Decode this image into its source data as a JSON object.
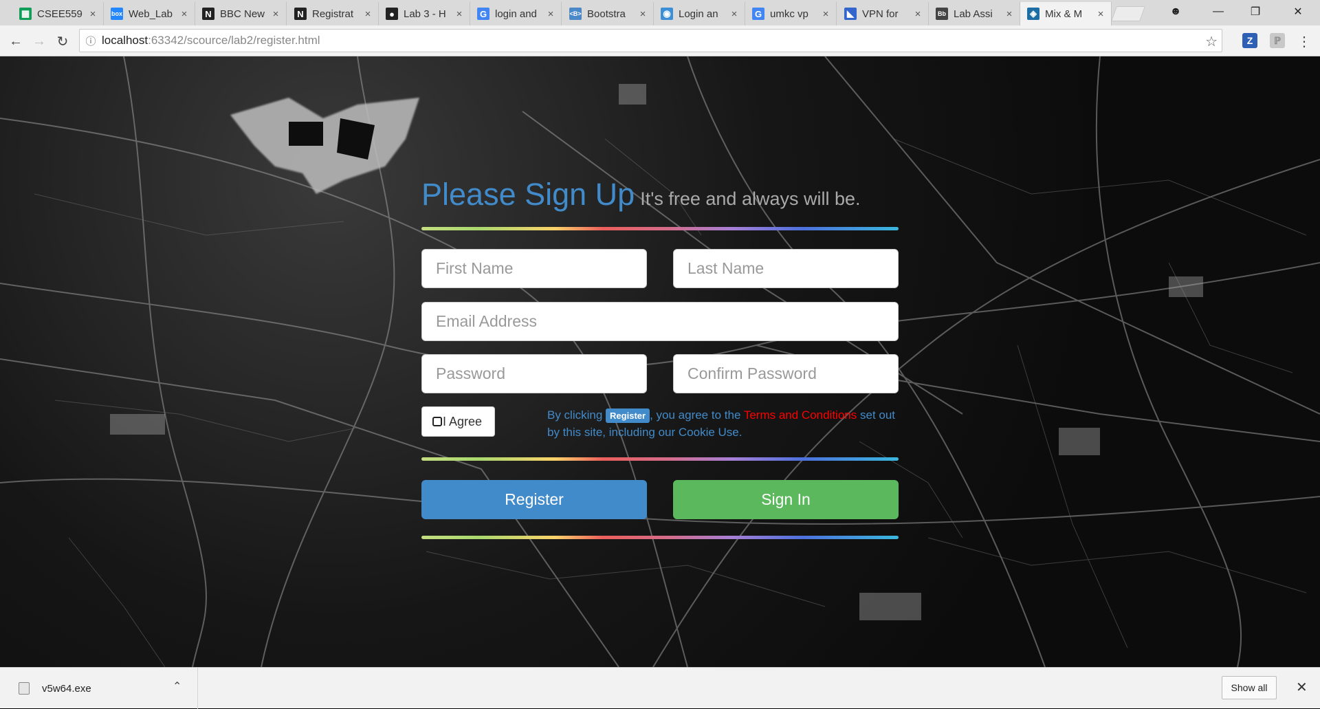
{
  "browser": {
    "tabs": [
      {
        "title": "CSEE559",
        "icon": "sheets-icon",
        "color": "#0f9d58",
        "glyph": "▦"
      },
      {
        "title": "Web_Lab",
        "icon": "box-icon",
        "color": "#2486fc",
        "glyph": "box"
      },
      {
        "title": "BBC New",
        "icon": "notion-icon",
        "color": "#222222",
        "glyph": "N"
      },
      {
        "title": "Registrat",
        "icon": "notion-icon",
        "color": "#222222",
        "glyph": "N"
      },
      {
        "title": "Lab 3 - H",
        "icon": "github-icon",
        "color": "#222222",
        "glyph": "●"
      },
      {
        "title": "login and",
        "icon": "google-icon",
        "color": "#4285f4",
        "glyph": "G"
      },
      {
        "title": "Bootstra",
        "icon": "bootstrap-icon",
        "color": "#4b88c7",
        "glyph": "<B>"
      },
      {
        "title": "Login an",
        "icon": "drop-icon",
        "color": "#3a8fd6",
        "glyph": "◉"
      },
      {
        "title": "umkc vp",
        "icon": "google-icon",
        "color": "#4285f4",
        "glyph": "G"
      },
      {
        "title": "VPN for",
        "icon": "vpn-icon",
        "color": "#3366cc",
        "glyph": "◣"
      },
      {
        "title": "Lab Assi",
        "icon": "lab-icon",
        "color": "#444444",
        "glyph": "Bb"
      },
      {
        "title": "Mix & M",
        "icon": "mix-icon",
        "color": "#1c6ea4",
        "glyph": "◈"
      }
    ],
    "close_glyph": "×",
    "url_host": "localhost",
    "url_path": ":63342/scource/lab2/register.html"
  },
  "form": {
    "heading": "Please Sign Up",
    "subheading": "It's free and always will be.",
    "first_name_placeholder": "First Name",
    "last_name_placeholder": "Last Name",
    "email_placeholder": "Email Address",
    "password_placeholder": "Password",
    "confirm_password_placeholder": "Confirm Password",
    "agree_label": "I Agree",
    "terms_prefix": "By clicking",
    "terms_badge": "Register",
    "terms_middle": ", you agree to the",
    "terms_link": "Terms and Conditions",
    "terms_suffix": "set out by this site, including our Cookie Use.",
    "register_button": "Register",
    "signin_button": "Sign In"
  },
  "downloads": {
    "file_name": "v5w64.exe",
    "show_all": "Show all"
  },
  "colors": {
    "primary": "#428bca",
    "success": "#5cb85c",
    "terms_red": "#ff0000"
  }
}
